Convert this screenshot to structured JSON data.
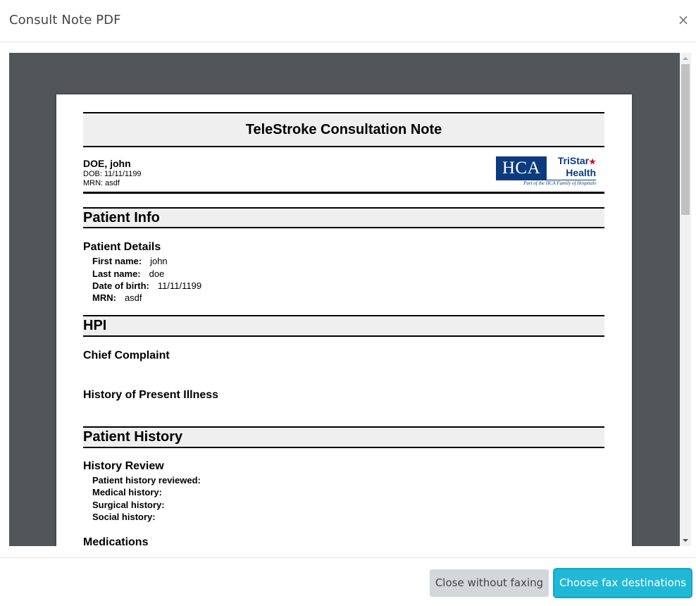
{
  "modal": {
    "title": "Consult Note PDF",
    "close_glyph": "×"
  },
  "document": {
    "title": "TeleStroke Consultation Note",
    "patient": {
      "name": "DOE, john",
      "dob_line": "DOB: 11/11/1199",
      "mrn_line": "MRN: asdf"
    },
    "logo": {
      "hca": "HCA",
      "tristar_line1": "TriStar",
      "tristar_line2": "Health",
      "tagline": "Part of the HCA Family of Hospitals"
    },
    "sections": {
      "patient_info": "Patient Info",
      "hpi": "HPI",
      "patient_history": "Patient History"
    },
    "patient_details": {
      "heading": "Patient Details",
      "first_name_label": "First name:",
      "first_name_value": "john",
      "last_name_label": "Last name:",
      "last_name_value": "doe",
      "dob_label": "Date of birth:",
      "dob_value": "11/11/1199",
      "mrn_label": "MRN:",
      "mrn_value": "asdf"
    },
    "hpi": {
      "chief_complaint": "Chief Complaint",
      "history_present_illness": "History of Present Illness"
    },
    "history_review": {
      "heading": "History Review",
      "reviewed_label": "Patient history reviewed:",
      "medical_label": "Medical history:",
      "surgical_label": "Surgical history:",
      "social_label": "Social history:"
    },
    "medications_heading": "Medications"
  },
  "footer": {
    "close_button": "Close without faxing",
    "primary_button": "Choose fax destinations"
  },
  "colors": {
    "viewer_bg": "#525659",
    "primary": "#1fb8d6",
    "secondary": "#d3d6db",
    "hca_blue": "#0b3a7e"
  }
}
